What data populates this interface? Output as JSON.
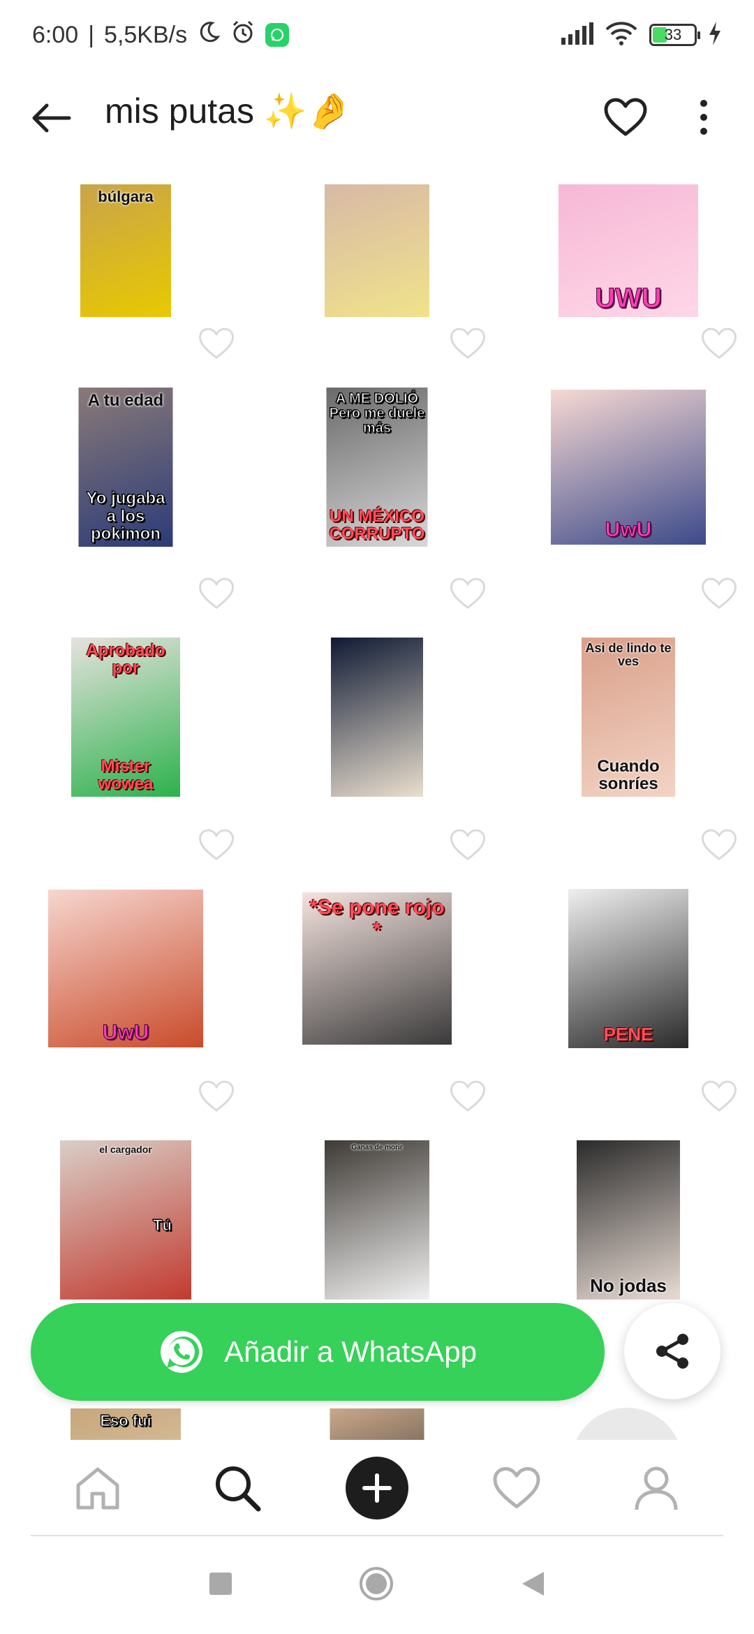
{
  "status_bar": {
    "time": "6:00",
    "separator": "|",
    "network_speed": "5,5KB/s",
    "battery": "33",
    "icons": [
      "moon-icon",
      "alarm-icon",
      "whatsapp-icon",
      "signal-icon",
      "wifi-icon",
      "battery-icon",
      "charging-icon"
    ]
  },
  "header": {
    "title": "mis putas ✨🤌",
    "back_icon": "arrow-left-icon",
    "favorite_icon": "heart-outline-icon",
    "more_icon": "more-vertical-icon"
  },
  "stickers": [
    {
      "id": "s1",
      "top_caption": "búlgara",
      "bottom_caption": "",
      "bg": "#c9a44a",
      "accent": "#e8c900"
    },
    {
      "id": "s2",
      "top_caption": "",
      "bottom_caption": "",
      "bg": "#d8b9a6",
      "accent": "#f0e38a"
    },
    {
      "id": "s3",
      "top_caption": "",
      "bottom_caption": "UWU",
      "bg": "#f6b8d6",
      "accent": "#ffd7e7"
    },
    {
      "id": "s4",
      "top_caption": "A tu edad",
      "bottom_caption": "Yo jugaba a los pokimon",
      "bg": "#8a7a78",
      "accent": "#2b3b78"
    },
    {
      "id": "s5",
      "top_caption": "A ME DOLIÓ Pero me duele más",
      "bottom_caption": "UN MÉXICO CORRUPTO",
      "bg": "#6a6a6a",
      "accent": "#d8d8d8"
    },
    {
      "id": "s6",
      "top_caption": "",
      "bottom_caption": "UwU",
      "bg": "#f7d9d3",
      "accent": "#3c4a8a"
    },
    {
      "id": "s7",
      "top_caption": "Aprobado por",
      "bottom_caption": "Mister wowea",
      "bg": "#e6e2dd",
      "accent": "#2bb24c"
    },
    {
      "id": "s8",
      "top_caption": "",
      "bottom_caption": "",
      "bg": "#0f1a33",
      "accent": "#eadfcf"
    },
    {
      "id": "s9",
      "top_caption": "Asi de lindo te ves",
      "bottom_caption": "Cuando sonríes",
      "bg": "#d9a08a",
      "accent": "#f3d3c4"
    },
    {
      "id": "s10",
      "top_caption": "",
      "bottom_caption": "UwU",
      "bg": "#f6d6cf",
      "accent": "#c94b2a"
    },
    {
      "id": "s11",
      "top_caption": "*Se pone rojo *",
      "bottom_caption": "",
      "bg": "#f4e3de",
      "accent": "#3a3a3a"
    },
    {
      "id": "s12",
      "top_caption": "",
      "bottom_caption": "PENE",
      "bg": "#efefef",
      "accent": "#2a2a2a"
    },
    {
      "id": "s13",
      "top_caption": "el cargador",
      "side_caption": "Tú",
      "bottom_caption": "",
      "bg": "#d9cfc7",
      "accent": "#c23a30"
    },
    {
      "id": "s14",
      "top_caption": "Ganas de morir",
      "bottom_caption": "",
      "bg": "#3f3a35",
      "accent": "#f1f1f1"
    },
    {
      "id": "s15",
      "top_caption": "",
      "bottom_caption": "No jodas",
      "bg": "#2b2b2b",
      "accent": "#e9dcd4"
    },
    {
      "id": "s16",
      "top_caption": "Eso fui",
      "bottom_caption": "",
      "bg": "#c7a77c",
      "accent": "#e4cfb2"
    },
    {
      "id": "s17",
      "top_caption": "",
      "bottom_caption": "",
      "bg": "#caa88a",
      "accent": "#2b2b2b"
    }
  ],
  "whatsapp_button": {
    "label": "Añadir a WhatsApp",
    "icon": "whatsapp-icon",
    "color": "#35d158"
  },
  "share_button": {
    "icon": "share-icon"
  },
  "bottom_nav": {
    "items": [
      "home-icon",
      "search-icon",
      "add-icon",
      "heart-icon",
      "profile-icon"
    ]
  },
  "system_nav": {
    "items": [
      "recents-square-icon",
      "home-circle-icon",
      "back-triangle-icon"
    ]
  }
}
